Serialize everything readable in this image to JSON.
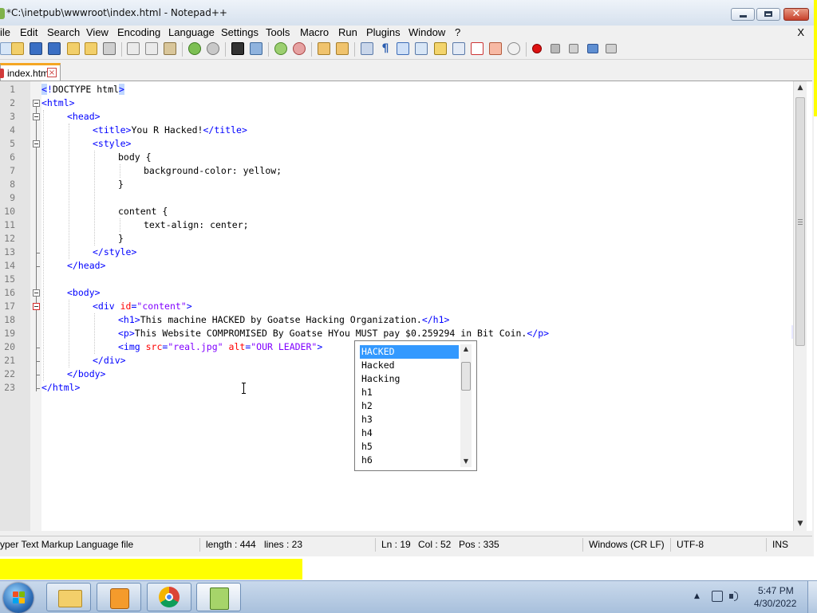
{
  "window": {
    "title": "*C:\\inetpub\\wwwroot\\index.html - Notepad++",
    "menu_close": "X"
  },
  "menu": [
    "ile",
    "Edit",
    "Search",
    "View",
    "Encoding",
    "Language",
    "Settings",
    "Tools",
    "Macro",
    "Run",
    "Plugins",
    "Window",
    "?"
  ],
  "tab": {
    "label": "index.html"
  },
  "editor": {
    "line_numbers": [
      "1",
      "2",
      "3",
      "4",
      "5",
      "6",
      "7",
      "8",
      "9",
      "10",
      "11",
      "12",
      "13",
      "14",
      "15",
      "16",
      "17",
      "18",
      "19",
      "20",
      "21",
      "22",
      "23"
    ],
    "current_line": 19
  },
  "autocomplete": {
    "items": [
      "HACKED",
      "Hacked",
      "Hacking",
      "h1",
      "h2",
      "h3",
      "h4",
      "h5",
      "h6"
    ],
    "selected": "HACKED"
  },
  "status": {
    "file_type": "yper Text Markup Language file",
    "length": "length : 444",
    "lines": "lines : 23",
    "ln": "Ln : 19",
    "col": "Col : 52",
    "pos": "Pos : 335",
    "eol": "Windows (CR LF)",
    "encoding": "UTF-8",
    "mode": "INS"
  },
  "taskbar": {
    "time": "5:47 PM",
    "date": "4/30/2022",
    "apps": [
      "file-explorer-icon",
      "media-player-icon",
      "chrome-icon",
      "notepadpp-icon"
    ]
  },
  "colors": {
    "tag": "#0000ff",
    "attribute": "#ff0000",
    "string": "#8000ff",
    "selection": "#3399ff",
    "highlight_strip": "#ffff00"
  }
}
